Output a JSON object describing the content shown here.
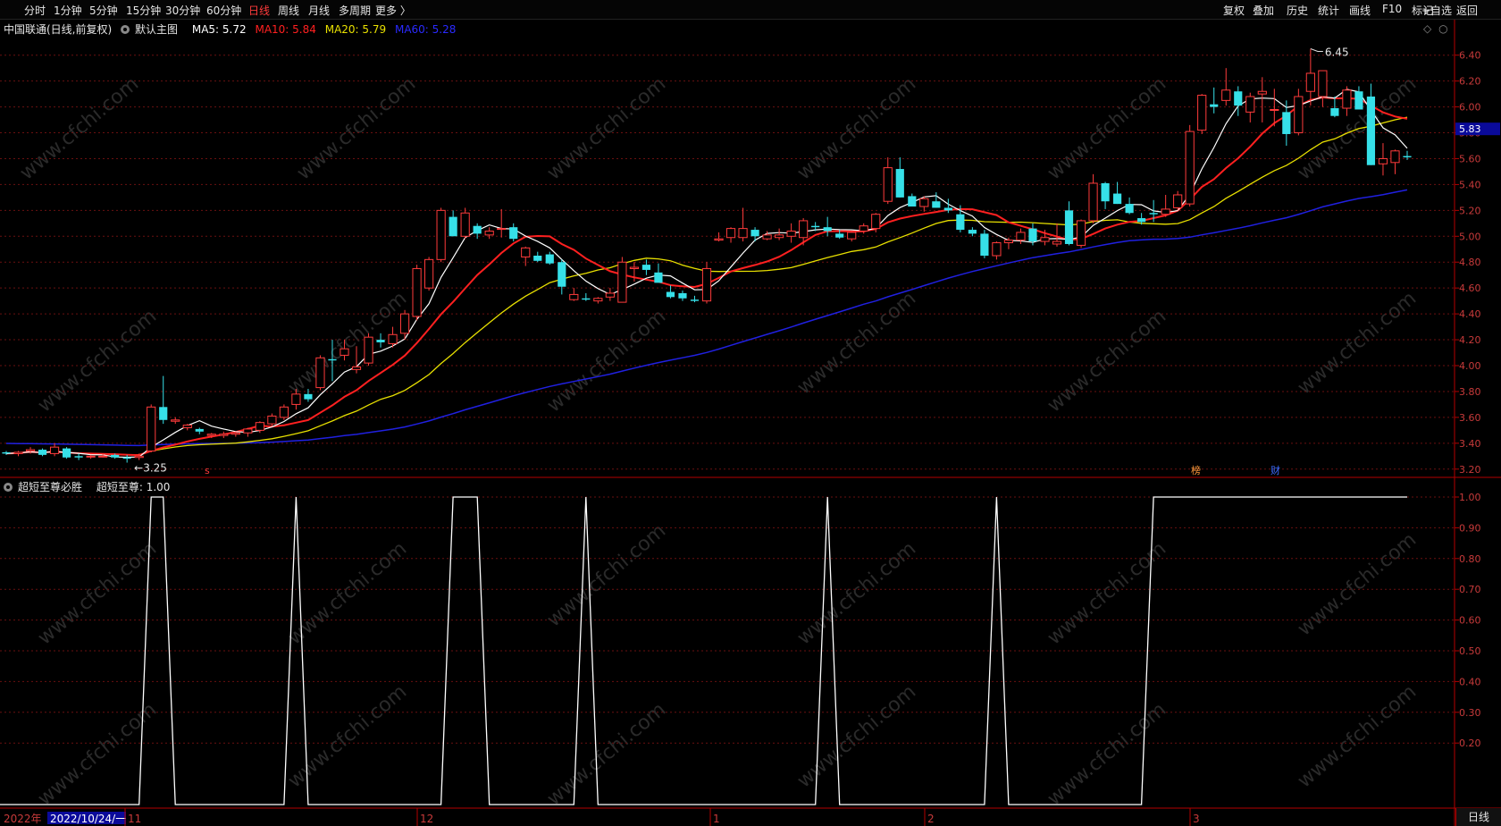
{
  "toolbar": {
    "periods": [
      {
        "label": "分时",
        "active": false
      },
      {
        "label": "1分钟",
        "active": false
      },
      {
        "label": "5分钟",
        "active": false
      },
      {
        "label": "15分钟",
        "active": false
      },
      {
        "label": "30分钟",
        "active": false
      },
      {
        "label": "60分钟",
        "active": false
      },
      {
        "label": "日线",
        "active": true
      },
      {
        "label": "周线",
        "active": false
      },
      {
        "label": "月线",
        "active": false
      },
      {
        "label": "多周期",
        "active": false
      },
      {
        "label": "更多 〉",
        "active": false
      }
    ],
    "right_buttons": [
      "复权",
      "叠加",
      "历史",
      "统计",
      "画线",
      "F10",
      "+自选",
      "返回"
    ],
    "mark_label": "标记"
  },
  "main_header": {
    "stock": "中国联通(日线,前复权)",
    "template": "默认主图",
    "ma5": "MA5: 5.72",
    "ma10": "MA10: 5.84",
    "ma20": "MA20: 5.79",
    "ma60": "MA60: 5.28"
  },
  "indicator_header": {
    "name": "超短至尊必胜",
    "value": "超短至尊: 1.00"
  },
  "price_axis": {
    "ticks": [
      "6.40",
      "6.20",
      "6.00",
      "5.80",
      "5.60",
      "5.40",
      "5.20",
      "5.00",
      "4.80",
      "4.60",
      "4.40",
      "4.20",
      "4.00",
      "3.80",
      "3.60",
      "3.40",
      "3.20"
    ],
    "current_price": "5.83",
    "high_label": "6.45",
    "low_label": "3.25"
  },
  "indicator_axis": {
    "ticks": [
      "1.00",
      "0.90",
      "0.80",
      "0.70",
      "0.60",
      "0.50",
      "0.40",
      "0.30",
      "0.20"
    ]
  },
  "event_markers": [
    {
      "label": "s",
      "color": "#ff3b3b"
    },
    {
      "label": "榜",
      "color": "#ff9a3c"
    },
    {
      "label": "财",
      "color": "#3b6bff"
    }
  ],
  "time_axis": {
    "year_label": "2022年",
    "cursor_date": "2022/10/24/一",
    "month_labels": [
      "11",
      "12",
      "1",
      "2",
      "3"
    ]
  },
  "bottom_right_button": "日线",
  "watermark": "www.cfchi.com",
  "colors": {
    "up": "#ff3b3b",
    "down": "#36e0e8",
    "ma5": "#ffffff",
    "ma10": "#ff2020",
    "ma20": "#e8e000",
    "ma60": "#2020e0",
    "axis": "#b30000",
    "grid": "#6a1010"
  },
  "chart_data": {
    "type": "candlestick",
    "price_range": [
      3.15,
      6.55
    ],
    "candles": [
      [
        3.33,
        3.34,
        3.31,
        3.32
      ],
      [
        3.32,
        3.34,
        3.3,
        3.33
      ],
      [
        3.34,
        3.37,
        3.32,
        3.35
      ],
      [
        3.35,
        3.36,
        3.3,
        3.31
      ],
      [
        3.32,
        3.4,
        3.3,
        3.37
      ],
      [
        3.36,
        3.37,
        3.28,
        3.29
      ],
      [
        3.3,
        3.32,
        3.27,
        3.29
      ],
      [
        3.3,
        3.31,
        3.28,
        3.3
      ],
      [
        3.3,
        3.32,
        3.29,
        3.3
      ],
      [
        3.31,
        3.32,
        3.28,
        3.29
      ],
      [
        3.29,
        3.31,
        3.25,
        3.28
      ],
      [
        3.29,
        3.32,
        3.27,
        3.3
      ],
      [
        3.34,
        3.7,
        3.33,
        3.68
      ],
      [
        3.68,
        3.92,
        3.55,
        3.58
      ],
      [
        3.57,
        3.6,
        3.55,
        3.58
      ],
      [
        3.52,
        3.55,
        3.5,
        3.54
      ],
      [
        3.51,
        3.52,
        3.47,
        3.49
      ],
      [
        3.46,
        3.48,
        3.44,
        3.47
      ],
      [
        3.46,
        3.49,
        3.44,
        3.47
      ],
      [
        3.47,
        3.49,
        3.45,
        3.48
      ],
      [
        3.48,
        3.52,
        3.45,
        3.51
      ],
      [
        3.5,
        3.57,
        3.48,
        3.56
      ],
      [
        3.55,
        3.63,
        3.53,
        3.61
      ],
      [
        3.6,
        3.7,
        3.58,
        3.68
      ],
      [
        3.7,
        3.82,
        3.66,
        3.78
      ],
      [
        3.78,
        3.82,
        3.72,
        3.74
      ],
      [
        3.83,
        4.08,
        3.81,
        4.06
      ],
      [
        4.05,
        4.2,
        3.88,
        4.04
      ],
      [
        4.08,
        4.2,
        4.04,
        4.13
      ],
      [
        3.97,
        4.15,
        3.94,
        3.99
      ],
      [
        4.02,
        4.25,
        4.0,
        4.22
      ],
      [
        4.2,
        4.25,
        4.14,
        4.18
      ],
      [
        4.17,
        4.3,
        4.14,
        4.24
      ],
      [
        4.25,
        4.43,
        4.2,
        4.4
      ],
      [
        4.38,
        4.78,
        4.35,
        4.75
      ],
      [
        4.6,
        4.84,
        4.58,
        4.82
      ],
      [
        4.82,
        5.22,
        4.8,
        5.2
      ],
      [
        5.15,
        5.2,
        5.0,
        5.0
      ],
      [
        5.0,
        5.22,
        4.98,
        5.18
      ],
      [
        5.08,
        5.1,
        4.98,
        5.02
      ],
      [
        5.01,
        5.07,
        4.98,
        5.04
      ],
      [
        5.06,
        5.21,
        4.99,
        5.06
      ],
      [
        5.07,
        5.1,
        4.96,
        4.98
      ],
      [
        4.84,
        4.92,
        4.77,
        4.91
      ],
      [
        4.85,
        4.88,
        4.8,
        4.81
      ],
      [
        4.86,
        4.88,
        4.78,
        4.79
      ],
      [
        4.8,
        4.82,
        4.55,
        4.61
      ],
      [
        4.51,
        4.6,
        4.5,
        4.55
      ],
      [
        4.52,
        4.56,
        4.5,
        4.51
      ],
      [
        4.5,
        4.53,
        4.48,
        4.52
      ],
      [
        4.53,
        4.6,
        4.5,
        4.56
      ],
      [
        4.49,
        4.84,
        4.49,
        4.8
      ],
      [
        4.75,
        4.8,
        4.65,
        4.76
      ],
      [
        4.78,
        4.82,
        4.7,
        4.74
      ],
      [
        4.72,
        4.79,
        4.65,
        4.64
      ],
      [
        4.57,
        4.62,
        4.52,
        4.53
      ],
      [
        4.56,
        4.58,
        4.5,
        4.52
      ],
      [
        4.51,
        4.54,
        4.49,
        4.5
      ],
      [
        4.5,
        4.8,
        4.48,
        4.75
      ],
      [
        4.97,
        5.03,
        4.96,
        4.98
      ],
      [
        4.99,
        5.07,
        4.95,
        5.06
      ],
      [
        4.99,
        5.22,
        4.96,
        5.06
      ],
      [
        5.05,
        5.07,
        4.96,
        5.0
      ],
      [
        4.98,
        5.04,
        4.97,
        5.01
      ],
      [
        4.99,
        5.06,
        4.97,
        5.01
      ],
      [
        5.0,
        5.1,
        4.95,
        5.04
      ],
      [
        4.99,
        5.14,
        4.93,
        5.12
      ],
      [
        5.08,
        5.11,
        5.04,
        5.07
      ],
      [
        5.07,
        5.15,
        5.0,
        5.04
      ],
      [
        5.02,
        5.05,
        4.98,
        4.99
      ],
      [
        4.98,
        5.04,
        4.96,
        5.03
      ],
      [
        5.04,
        5.1,
        5.02,
        5.08
      ],
      [
        5.06,
        5.18,
        5.03,
        5.17
      ],
      [
        5.27,
        5.61,
        5.25,
        5.53
      ],
      [
        5.52,
        5.61,
        5.3,
        5.3
      ],
      [
        5.31,
        5.33,
        5.23,
        5.23
      ],
      [
        5.23,
        5.31,
        5.19,
        5.29
      ],
      [
        5.27,
        5.34,
        5.22,
        5.22
      ],
      [
        5.22,
        5.29,
        5.18,
        5.2
      ],
      [
        5.17,
        5.24,
        5.03,
        5.05
      ],
      [
        5.05,
        5.07,
        5.0,
        5.02
      ],
      [
        5.02,
        5.05,
        4.83,
        4.85
      ],
      [
        4.85,
        4.96,
        4.82,
        4.95
      ],
      [
        4.95,
        4.99,
        4.9,
        4.97
      ],
      [
        4.97,
        5.06,
        4.94,
        5.03
      ],
      [
        5.06,
        5.1,
        4.93,
        4.96
      ],
      [
        4.96,
        5.05,
        4.93,
        4.99
      ],
      [
        4.94,
        5.1,
        4.92,
        4.96
      ],
      [
        5.2,
        5.27,
        4.93,
        4.94
      ],
      [
        4.93,
        5.13,
        4.91,
        5.12
      ],
      [
        5.12,
        5.48,
        5.1,
        5.41
      ],
      [
        5.41,
        5.42,
        5.21,
        5.27
      ],
      [
        5.33,
        5.42,
        5.25,
        5.25
      ],
      [
        5.25,
        5.3,
        5.17,
        5.18
      ],
      [
        5.14,
        5.18,
        5.09,
        5.11
      ],
      [
        5.18,
        5.28,
        5.11,
        5.17
      ],
      [
        5.17,
        5.32,
        5.15,
        5.21
      ],
      [
        5.22,
        5.35,
        5.2,
        5.32
      ],
      [
        5.25,
        5.86,
        5.23,
        5.81
      ],
      [
        5.82,
        6.1,
        5.79,
        6.09
      ],
      [
        6.02,
        6.15,
        5.95,
        6.0
      ],
      [
        6.05,
        6.3,
        6.01,
        6.13
      ],
      [
        6.12,
        6.16,
        5.93,
        6.01
      ],
      [
        5.96,
        6.11,
        5.88,
        6.08
      ],
      [
        6.1,
        6.23,
        5.88,
        6.12
      ],
      [
        5.98,
        6.14,
        5.85,
        5.98
      ],
      [
        5.96,
        6.05,
        5.7,
        5.79
      ],
      [
        5.8,
        6.14,
        5.78,
        6.08
      ],
      [
        6.12,
        6.45,
        6.01,
        6.26
      ],
      [
        6.08,
        6.28,
        6.0,
        6.28
      ],
      [
        5.99,
        6.08,
        5.92,
        5.93
      ],
      [
        5.99,
        6.16,
        5.93,
        6.13
      ],
      [
        6.12,
        6.16,
        5.98,
        5.98
      ],
      [
        6.08,
        6.18,
        5.55,
        5.55
      ],
      [
        5.56,
        5.72,
        5.47,
        5.6
      ],
      [
        5.57,
        5.67,
        5.48,
        5.66
      ],
      [
        5.62,
        5.66,
        5.59,
        5.61
      ]
    ],
    "indicator_range": [
      0.0,
      1.0
    ],
    "indicator_name": "超短至尊",
    "indicator_last": 1.0
  }
}
